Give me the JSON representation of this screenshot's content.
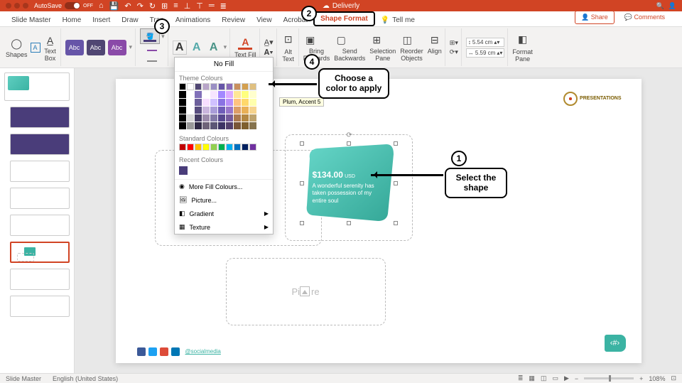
{
  "title_bar": {
    "autosave_label": "AutoSave",
    "autosave_state": "OFF",
    "doc_title": "Deliverly"
  },
  "tabs": {
    "slide_master": "Slide Master",
    "home": "Home",
    "insert": "Insert",
    "draw": "Draw",
    "transitions": "Tran",
    "animations": "Animations",
    "review": "Review",
    "view": "View",
    "acrobat": "Acrobat",
    "shape_format": "Shape Format",
    "tell_me": "Tell me",
    "share": "Share",
    "comments": "Comments"
  },
  "ribbon": {
    "shapes": "Shapes",
    "textbox": "Text\nBox",
    "abc": "Abc",
    "textfill": "Text Fill",
    "alttext": "Alt\nText",
    "bring_forwards": "Bring\nForwards",
    "send_backwards": "Send\nBackwards",
    "selection_pane": "Selection\nPane",
    "reorder_objects": "Reorder\nObjects",
    "align": "Align",
    "height": "5.54 cm",
    "width": "5.59 cm",
    "format_pane": "Format\nPane"
  },
  "dropdown": {
    "nofill": "No Fill",
    "theme": "Theme Colours",
    "standard": "Standard Colours",
    "recent": "Recent Colours",
    "more": "More Fill Colours...",
    "picture": "Picture...",
    "gradient": "Gradient",
    "texture": "Texture",
    "tooltip": "Plum, Accent 5",
    "theme_row": [
      "#000000",
      "#ffffff",
      "#504673",
      "#b8a5c9",
      "#9a8fc4",
      "#6655a8",
      "#8a6bb8",
      "#c9905e",
      "#d4a04f",
      "#e0c080"
    ],
    "standard_row": [
      "#c00000",
      "#ff0000",
      "#ffc000",
      "#ffff00",
      "#92d050",
      "#00b050",
      "#00b0f0",
      "#0070c0",
      "#002060",
      "#7030a0"
    ]
  },
  "slide": {
    "price": "$134.00",
    "currency": "USD",
    "desc": "A wonderful serenity has taken possession of my entire soul",
    "placeholder": "Pi",
    "placeholder_suffix": "re",
    "social_link": "@socialmedia",
    "logo_text": "PRESENTATIONS"
  },
  "steps": {
    "s1": "1",
    "s1_label": "Select the\nshape",
    "s2": "2",
    "s3": "3",
    "s4": "4",
    "s4_label": "Choose a\ncolor to apply"
  },
  "status": {
    "view": "Slide Master",
    "lang": "English (United States)",
    "zoom": "108%"
  }
}
